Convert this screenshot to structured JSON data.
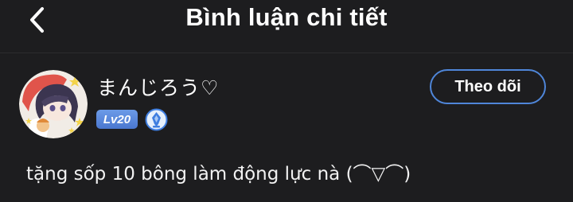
{
  "header": {
    "title": "Bình luận chi tiết",
    "back_icon": "chevron-left-icon"
  },
  "user": {
    "name": "まんじろう♡",
    "level": "Lv20",
    "rank_icon": "blue-crest-icon",
    "avatar": "anime-character-avatar"
  },
  "actions": {
    "follow_label": "Theo dõi"
  },
  "comment": {
    "text": "tặng sốp 10 bông làm động lực nà (⌒▽⌒)"
  },
  "colors": {
    "background": "#1d1d1f",
    "accent": "#4f86d9",
    "level_badge": "#5b88dc"
  }
}
